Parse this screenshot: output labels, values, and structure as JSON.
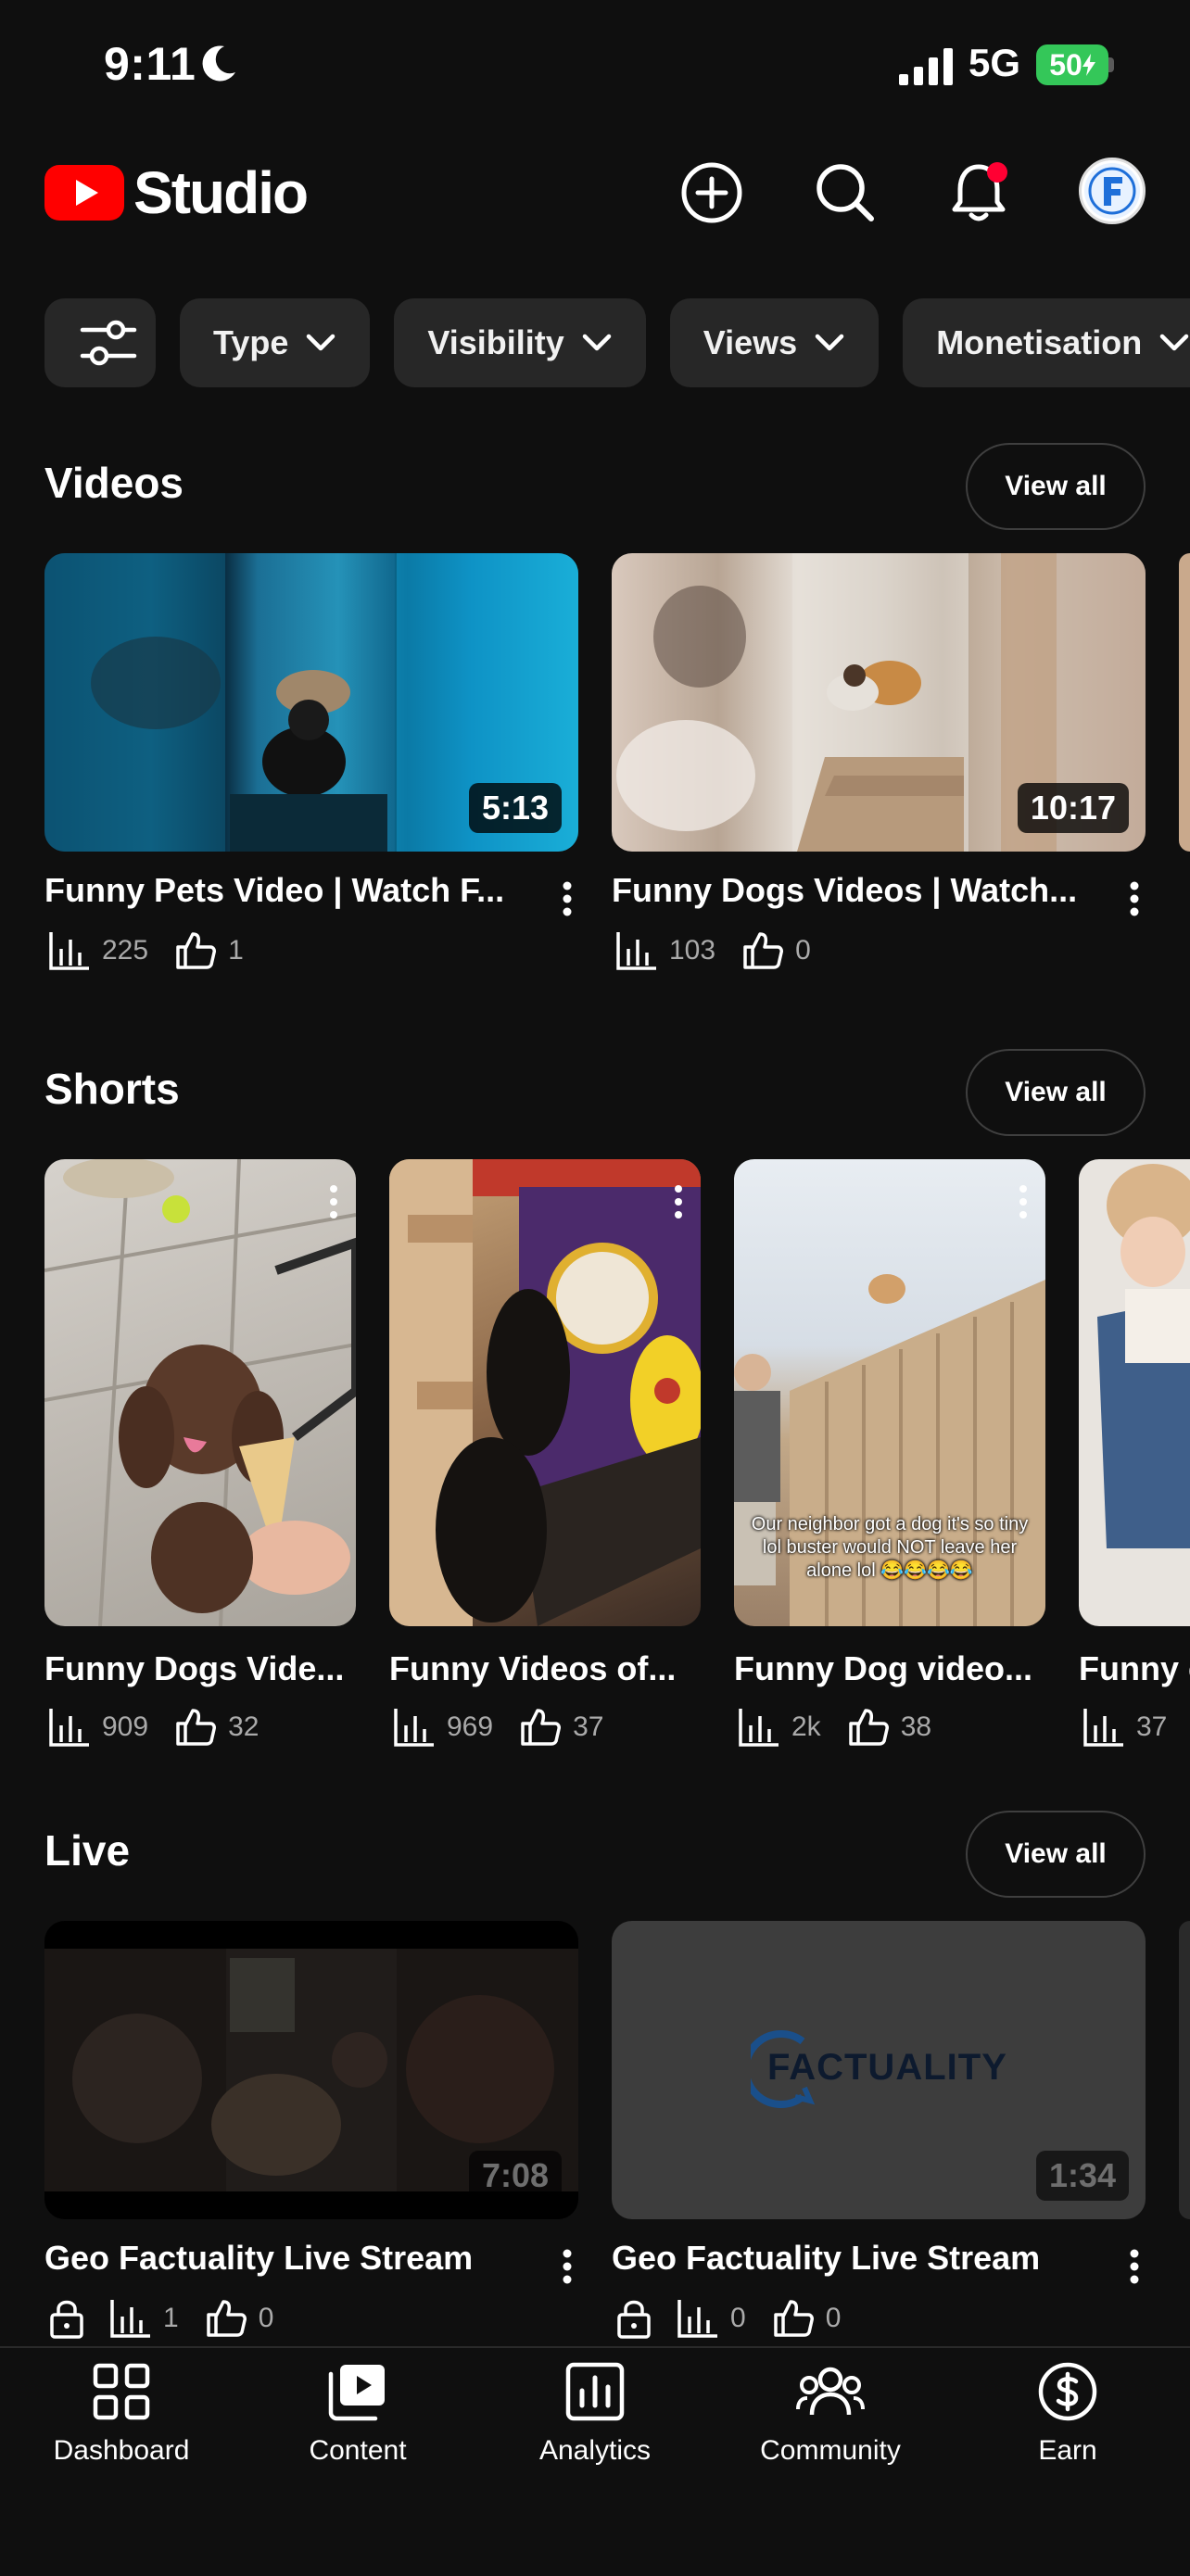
{
  "status_bar": {
    "time": "9:11",
    "network": "5G",
    "battery": "50"
  },
  "app": {
    "title": "Studio"
  },
  "filters": {
    "chips": [
      "Type",
      "Visibility",
      "Views",
      "Monetisation"
    ]
  },
  "sections": {
    "videos": {
      "title": "Videos",
      "view_all": "View all",
      "items": [
        {
          "title": "Funny Pets Video | Watch F...",
          "duration": "5:13",
          "views": "225",
          "likes": "1"
        },
        {
          "title": "Funny Dogs Videos | Watch...",
          "duration": "10:17",
          "views": "103",
          "likes": "0"
        }
      ]
    },
    "shorts": {
      "title": "Shorts",
      "view_all": "View all",
      "items": [
        {
          "title": "Funny Dogs Vide...",
          "views": "909",
          "likes": "32"
        },
        {
          "title": "Funny Videos of...",
          "views": "969",
          "likes": "37"
        },
        {
          "title": "Funny Dog video...",
          "views": "2k",
          "likes": "38",
          "overlay_text": "Our neighbor got a dog it's so tiny lol buster would NOT leave her alone lol 😂😂😂😂"
        },
        {
          "title": "Funny c",
          "views": "37"
        }
      ]
    },
    "live": {
      "title": "Live",
      "view_all": "View all",
      "items": [
        {
          "title": "Geo Factuality Live Stream",
          "duration": "7:08",
          "views": "1",
          "likes": "0"
        },
        {
          "title": "Geo Factuality Live Stream",
          "duration": "1:34",
          "views": "0",
          "likes": "0",
          "brand": "FACTUALITY"
        }
      ]
    }
  },
  "bottom_nav": {
    "items": [
      {
        "label": "Dashboard"
      },
      {
        "label": "Content"
      },
      {
        "label": "Analytics"
      },
      {
        "label": "Community"
      },
      {
        "label": "Earn"
      }
    ]
  },
  "colors": {
    "background": "#0f0f0f",
    "chip": "#272727",
    "youtube_red": "#ff0000",
    "notification_dot": "#ff0033",
    "battery": "#34c759"
  }
}
